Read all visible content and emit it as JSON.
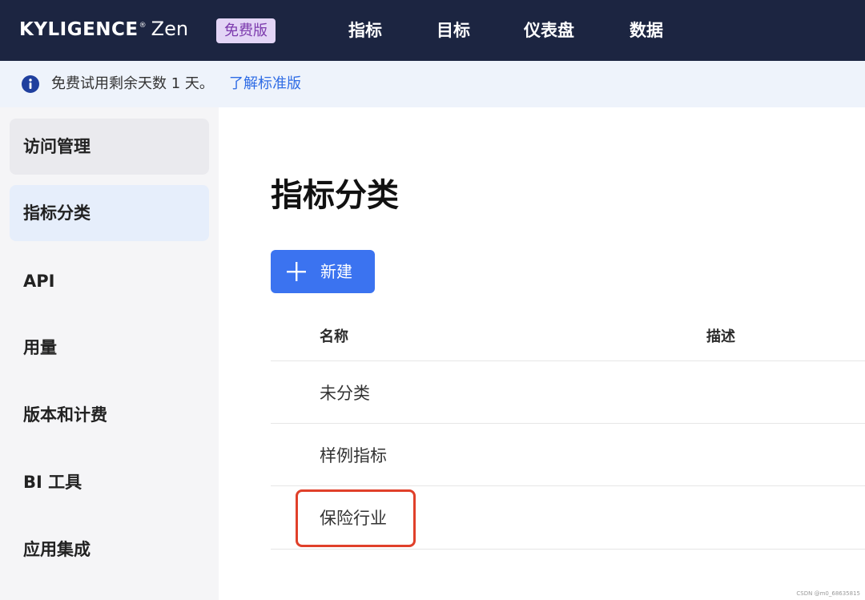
{
  "header": {
    "logo_text": "KYLIGENCE",
    "logo_registered": "®",
    "logo_product": "Zen",
    "edition_badge": "免费版",
    "nav": [
      "指标",
      "目标",
      "仪表盘",
      "数据"
    ]
  },
  "banner": {
    "icon": "info-icon",
    "text": "免费试用剩余天数 1 天。",
    "link": "了解标准版"
  },
  "sidebar": {
    "items": [
      {
        "label": "访问管理",
        "state": "hover"
      },
      {
        "label": "指标分类",
        "state": "active"
      },
      {
        "label": "API",
        "state": ""
      },
      {
        "label": "用量",
        "state": ""
      },
      {
        "label": "版本和计费",
        "state": ""
      },
      {
        "label": "BI 工具",
        "state": ""
      },
      {
        "label": "应用集成",
        "state": ""
      }
    ]
  },
  "main": {
    "title": "指标分类",
    "new_button": {
      "icon": "plus-icon",
      "label": "新建"
    },
    "table": {
      "columns": [
        "名称",
        "描述"
      ],
      "rows": [
        {
          "name": "未分类",
          "description": ""
        },
        {
          "name": "样例指标",
          "description": ""
        },
        {
          "name": "保险行业",
          "description": "",
          "highlighted": true
        }
      ]
    }
  },
  "watermark": "CSDN @m0_68635815",
  "colors": {
    "header_bg": "#1c2541",
    "banner_bg": "#eef3fb",
    "link": "#2f6ce5",
    "primary_button": "#3b73f0",
    "highlight_border": "#e0402a",
    "badge_bg": "#e3d5f6",
    "badge_text": "#7c3aad"
  }
}
